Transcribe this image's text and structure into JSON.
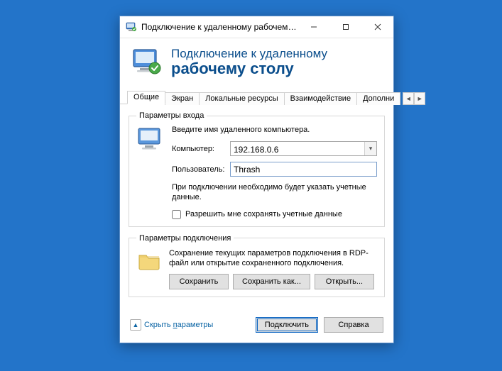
{
  "titlebar": {
    "title": "Подключение к удаленному рабочему с..."
  },
  "header": {
    "line1": "Подключение к удаленному",
    "line2": "рабочему столу"
  },
  "tabs": {
    "general": "Общие",
    "display": "Экран",
    "local": "Локальные ресурсы",
    "experience": "Взаимодействие",
    "advanced": "Дополни"
  },
  "login_group": {
    "legend": "Параметры входа",
    "intro": "Введите имя удаленного компьютера.",
    "computer_label": "Компьютер:",
    "computer_value": "192.168.0.6",
    "user_label": "Пользователь:",
    "user_value": "Thrash",
    "note": "При подключении необходимо будет указать учетные данные.",
    "save_creds": "Разрешить мне сохранять учетные данные"
  },
  "conn_group": {
    "legend": "Параметры подключения",
    "desc": "Сохранение текущих параметров подключения в RDP-файл или открытие сохраненного подключения.",
    "save": "Сохранить",
    "save_as": "Сохранить как...",
    "open": "Открыть..."
  },
  "footer": {
    "hide_prefix": "Скрыть ",
    "hide_underlined": "п",
    "hide_suffix": "араметры",
    "connect": "Подключить",
    "help": "Справка"
  }
}
